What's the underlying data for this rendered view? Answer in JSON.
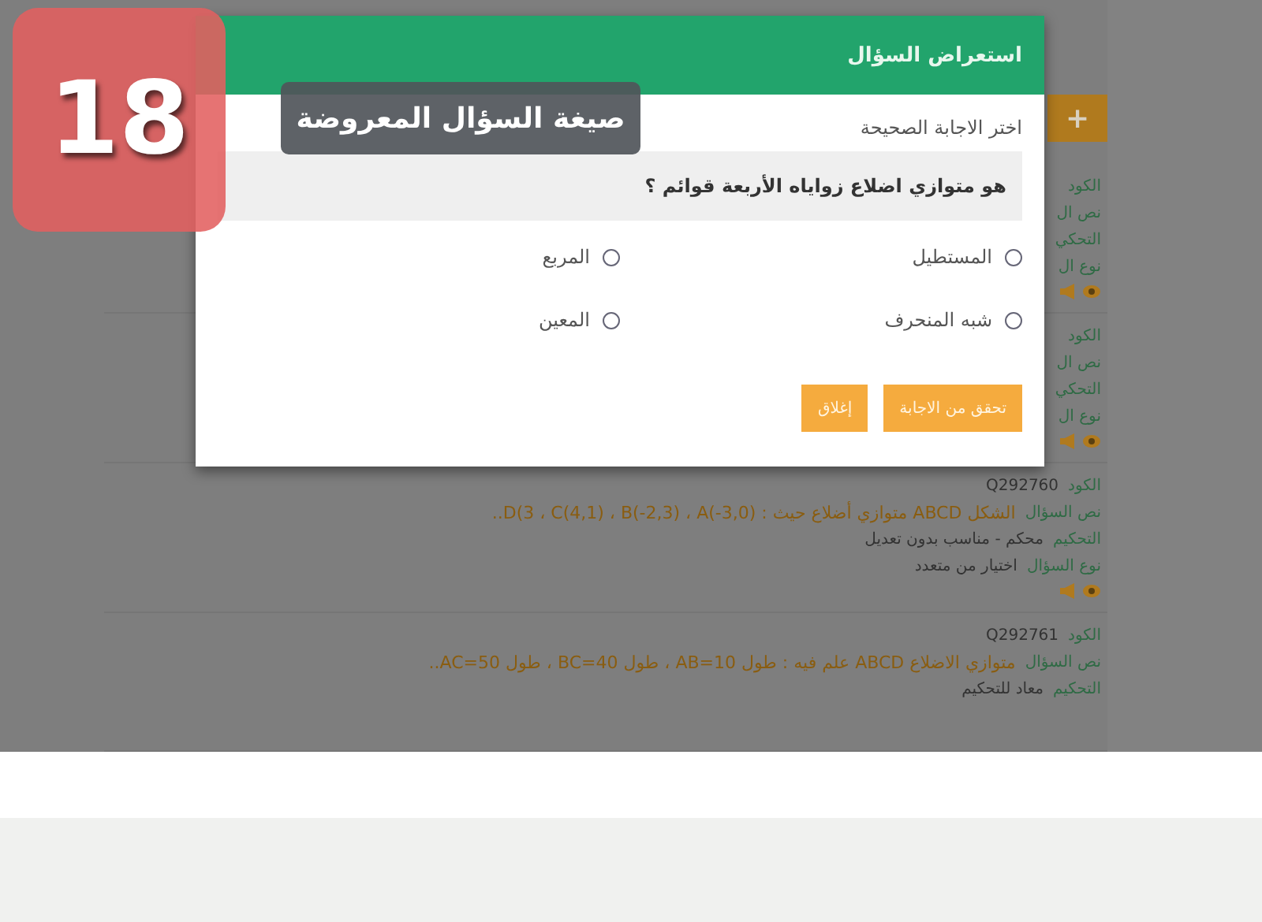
{
  "annotation": {
    "number": "18",
    "caption": "صيغة السؤال المعروضة"
  },
  "page": {
    "add_button": "+",
    "questions": [
      {
        "icons": true,
        "fields": [
          {
            "label": "الكود"
          },
          {
            "label": "نص ال"
          },
          {
            "label": "التحكي"
          },
          {
            "label": "نوع ال"
          }
        ]
      },
      {
        "icons": true,
        "fields": [
          {
            "label": "الكود"
          },
          {
            "label": "نص ال"
          },
          {
            "label": "التحكي"
          },
          {
            "label": "نوع ال"
          }
        ]
      },
      {
        "icons": true,
        "fields": [
          {
            "label": "الكود",
            "value": "Q292760",
            "kind": "plain"
          },
          {
            "label": "نص السؤال",
            "value": "الشكل ABCD متوازي أضلاع حيث : D(3 ، C(4,1) ، B(-2,3) ، A(-3,0)..",
            "kind": "accent"
          },
          {
            "label": "التحكيم",
            "value": "محكم - مناسب بدون تعديل",
            "kind": "plain"
          },
          {
            "label": "نوع السؤال",
            "value": "اختيار من متعدد",
            "kind": "plain"
          }
        ]
      },
      {
        "icons": false,
        "fields": [
          {
            "label": "الكود",
            "value": "Q292761",
            "kind": "plain"
          },
          {
            "label": "نص السؤال",
            "value": "متوازي الاضلاع ABCD علم فيه : طول AB=10 ، طول BC=40 ، طول AC=50..",
            "kind": "accent"
          },
          {
            "label": "التحكيم",
            "value": "معاد للتحكيم",
            "kind": "plain"
          }
        ]
      }
    ]
  },
  "dialog": {
    "title": "استعراض السؤال",
    "prompt": "اختر الاجابة الصحيحة",
    "question": "هو متوازي اضلاع زواياه الأربعة قوائم ؟",
    "options": [
      {
        "label": "المستطيل",
        "selected": false
      },
      {
        "label": "المربع",
        "selected": false
      },
      {
        "label": "شبه المنحرف",
        "selected": false
      },
      {
        "label": "المعين",
        "selected": false
      }
    ],
    "buttons": [
      "تحقق من الاجابة",
      "إغلاق"
    ]
  }
}
